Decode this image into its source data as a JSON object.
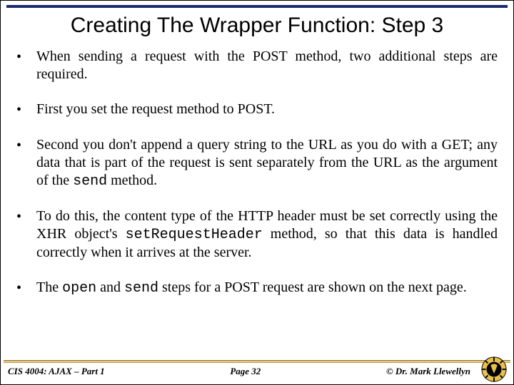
{
  "title": "Creating The Wrapper Function: Step 3",
  "bullets": {
    "b0": "When sending a request with the POST method, two additional steps are required.",
    "b1": "First you set the request method to POST.",
    "b2_a": "Second you don't append a query string to the URL as you do with a GET; any data that is part of the request is sent separately from the URL as the argument of the ",
    "b2_code": "send",
    "b2_b": " method.",
    "b3_a": "To do this, the content type of the HTTP header must be set correctly using the XHR object's ",
    "b3_code": "setRequestHeader",
    "b3_b": " method, so that this data is handled correctly when it arrives at the server.",
    "b4_a": "The ",
    "b4_code1": "open",
    "b4_mid": " and ",
    "b4_code2": "send",
    "b4_b": " steps for a POST request are shown on the next page."
  },
  "footer": {
    "course": "CIS 4004: AJAX – Part 1",
    "page": "Page 32",
    "copyright": "© Dr. Mark Llewellyn"
  }
}
